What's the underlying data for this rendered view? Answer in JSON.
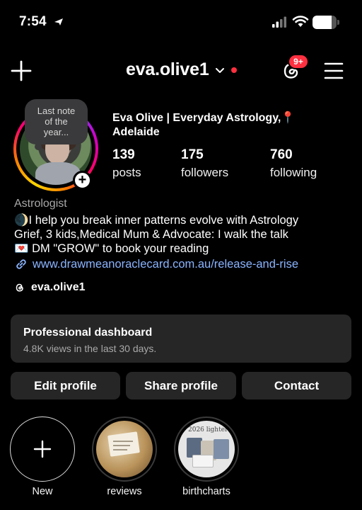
{
  "status_bar": {
    "time": "7:54",
    "battery_level": 0.78
  },
  "header": {
    "username": "eva.olive1",
    "notification_badge": "9+"
  },
  "profile": {
    "note_line1": "Last note",
    "note_line2": "of the",
    "note_line3": "year...",
    "display_name": "Eva Olive | Everyday Astrology,📍Adelaide",
    "stats": [
      {
        "value": "139",
        "label": "posts"
      },
      {
        "value": "175",
        "label": "followers"
      },
      {
        "value": "760",
        "label": "following"
      }
    ],
    "category": "Astrologist",
    "bio_line1": "🌒I help you break inner patterns evolve with Astrology",
    "bio_line2": "Grief, 3 kids,Medical Mum & Advocate: I walk the talk",
    "bio_line3": "💌 DM \"GROW\" to book your reading",
    "link": "www.drawmeanoraclecard.com.au/release-and-rise",
    "threads_handle": "eva.olive1"
  },
  "dashboard": {
    "title": "Professional dashboard",
    "subtitle": "4.8K views in the last 30 days."
  },
  "actions": {
    "edit": "Edit profile",
    "share": "Share profile",
    "contact": "Contact"
  },
  "highlights": [
    {
      "label": "New"
    },
    {
      "label": "reviews"
    },
    {
      "label": "birthcharts",
      "image_text": "2026 lighter"
    }
  ]
}
